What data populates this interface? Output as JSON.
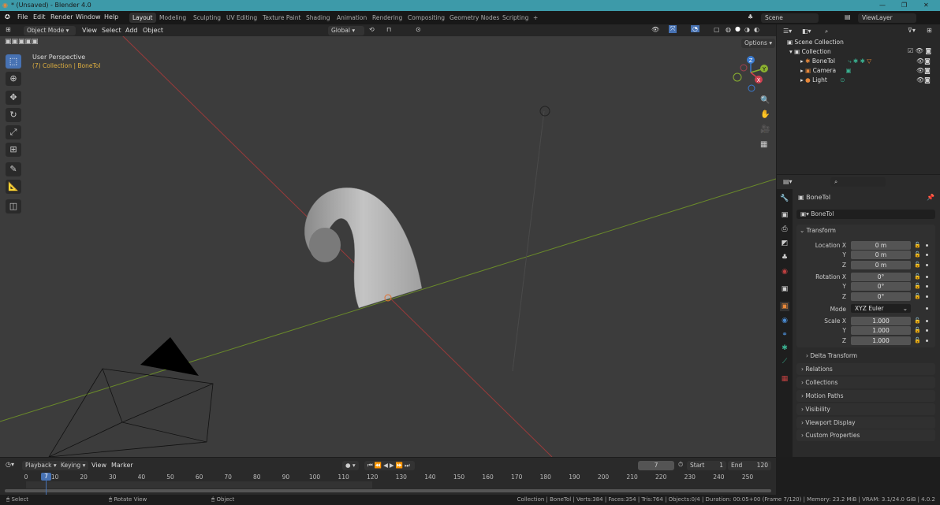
{
  "window": {
    "title": "* (Unsaved) - Blender 4.0",
    "min": "—",
    "max": "❐",
    "close": "✕"
  },
  "menu": [
    "File",
    "Edit",
    "Render",
    "Window",
    "Help"
  ],
  "workspaces": [
    "Layout",
    "Modeling",
    "Sculpting",
    "UV Editing",
    "Texture Paint",
    "Shading",
    "Animation",
    "Rendering",
    "Compositing",
    "Geometry Nodes",
    "Scripting",
    "+"
  ],
  "scene": {
    "name": "Scene",
    "view_layer": "ViewLayer"
  },
  "viewport": {
    "mode": "Object Mode",
    "menus": [
      "View",
      "Select",
      "Add",
      "Object"
    ],
    "orientation": "Global",
    "options": "Options",
    "perspective": "User Perspective",
    "context": "(7) Collection | BoneTol",
    "gizmo": {
      "x": "X",
      "y": "Y",
      "z": "Z"
    }
  },
  "outliner": {
    "root": "Scene Collection",
    "collection": "Collection",
    "items": [
      {
        "name": "BoneTol",
        "color": "#e8883a"
      },
      {
        "name": "Camera",
        "color": "#e8883a"
      },
      {
        "name": "Light",
        "color": "#e8883a"
      }
    ]
  },
  "properties": {
    "object_name": "BoneTol",
    "datablock": "BoneTol",
    "transform_label": "Transform",
    "location_label": "Location X",
    "rotation_label": "Rotation X",
    "scale_label": "Scale X",
    "mode_label": "Mode",
    "y": "Y",
    "z": "Z",
    "location": [
      "0 m",
      "0 m",
      "0 m"
    ],
    "rotation": [
      "0°",
      "0°",
      "0°"
    ],
    "mode": "XYZ Euler",
    "scale": [
      "1.000",
      "1.000",
      "1.000"
    ],
    "sections": [
      "Delta Transform",
      "Relations",
      "Collections",
      "Motion Paths",
      "Visibility",
      "Viewport Display",
      "Custom Properties"
    ]
  },
  "timeline": {
    "menus": [
      "Playback",
      "Keying",
      "View",
      "Marker"
    ],
    "current_frame": "7",
    "start_label": "Start",
    "start": "1",
    "end_label": "End",
    "end": "120",
    "ticks": [
      "0",
      "10",
      "20",
      "30",
      "40",
      "50",
      "60",
      "70",
      "80",
      "90",
      "100",
      "110",
      "120",
      "130",
      "140",
      "150",
      "160",
      "170",
      "180",
      "190",
      "200",
      "210",
      "220",
      "230",
      "240",
      "250"
    ]
  },
  "status": {
    "select": "Select",
    "rotate": "Rotate View",
    "object": "Object",
    "info": "Collection | BoneTol | Verts:384 | Faces:354 | Tris:764 | Objects:0/4 | Duration: 00:05+00 (Frame 7/120) | Memory: 23.2 MiB | VRAM: 3.1/24.0 GiB | 4.0.2"
  },
  "colors": {
    "accent": "#4772b3",
    "titlebar": "#3d9aa9",
    "x_axis": "#c0404a",
    "y_axis": "#7a9a2a"
  }
}
